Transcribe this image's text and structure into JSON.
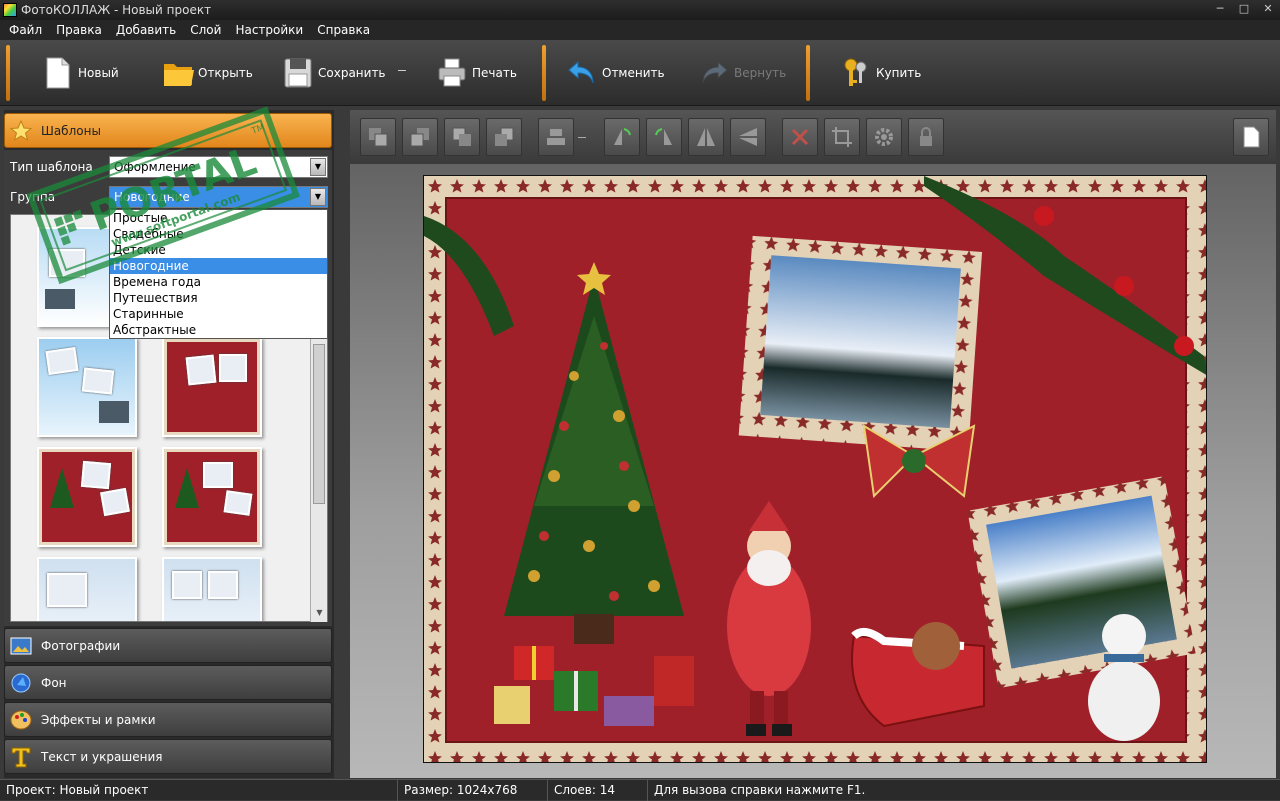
{
  "window": {
    "title": "ФотоКОЛЛАЖ - Новый проект",
    "controls": [
      "minimize-icon",
      "maximize-icon",
      "close-icon"
    ]
  },
  "menu": [
    "Файл",
    "Правка",
    "Добавить",
    "Слой",
    "Настройки",
    "Справка"
  ],
  "toolbar": {
    "new": "Новый",
    "open": "Открыть",
    "save": "Сохранить",
    "print": "Печать",
    "undo": "Отменить",
    "redo": "Вернуть",
    "buy": "Купить"
  },
  "left_panel": {
    "templates_header": "Шаблоны",
    "template_type_label": "Тип шаблона",
    "template_type_value": "Оформление",
    "group_label": "Группа",
    "group_value": "Новогодние",
    "group_options": [
      "Простые",
      "Свадебные",
      "Детские",
      "Новогодние",
      "Времена года",
      "Путешествия",
      "Старинные",
      "Абстрактные"
    ],
    "group_selected_index": 3,
    "categories": [
      "Фотографии",
      "Фон",
      "Эффекты и рамки",
      "Текст и украшения"
    ]
  },
  "watermark": {
    "line1": "PORTAL",
    "line2": "www.softportal.com",
    "tm": "TM"
  },
  "statusbar": {
    "project": "Проект: Новый проект",
    "size": "Размер: 1024x768",
    "layers": "Слоев: 14",
    "hint": "Для вызова справки нажмите F1."
  },
  "colors": {
    "accent": "#f0a030",
    "collage_bg": "#a0202a",
    "selection": "#3a8ee6"
  }
}
